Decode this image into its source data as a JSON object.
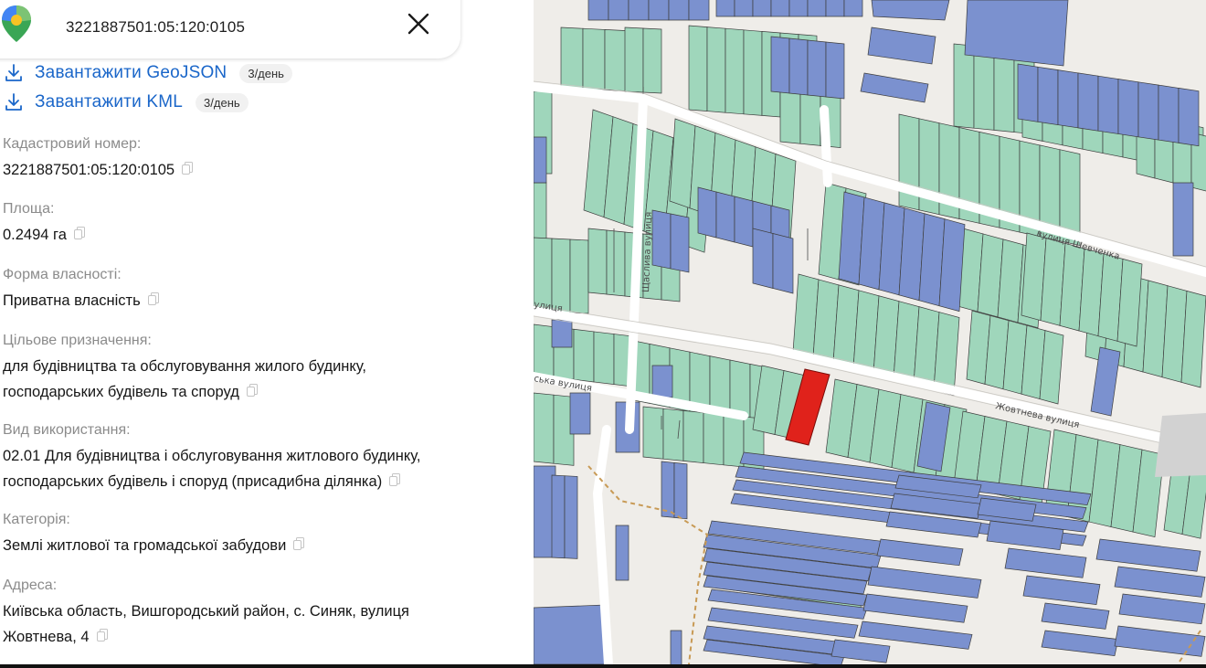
{
  "search": {
    "query": "3221887501:05:120:0105"
  },
  "downloads": [
    {
      "label": "Завантажити GeoJSON",
      "quota": "3/день"
    },
    {
      "label": "Завантажити KML",
      "quota": "3/день"
    }
  ],
  "details": {
    "cadastral": {
      "label": "Кадастровий номер:",
      "value": "3221887501:05:120:0105"
    },
    "area": {
      "label": "Площа:",
      "value": "0.2494 га"
    },
    "ownership": {
      "label": "Форма власності:",
      "value": "Приватна власність"
    },
    "purpose": {
      "label": "Цільове призначення:",
      "line1": "для будівництва та обслуговування жилого будинку,",
      "line2": "господарських будівель та споруд"
    },
    "usage": {
      "label": "Вид використання:",
      "line1": "02.01 Для будівництва і обслуговування житлового будинку,",
      "line2": "господарських будівель і споруд (присадибна ділянка)"
    },
    "category": {
      "label": "Категорія:",
      "value": "Землі житлової та громадської забудови"
    },
    "address": {
      "label": "Адреса:",
      "line1": "Київська область, Вишгородський район, с. Синяк, вулиця",
      "line2": "Жовтнева, 4"
    }
  },
  "map": {
    "streets": {
      "shevchenka": "вулиця Шевченка",
      "shchaslyva": "Щаслива вулиця",
      "zhovtneva": "Жовтнева вулиця",
      "edge_upper": "улиця",
      "edge_lower": "ська вулиця"
    },
    "colors": {
      "private": "#9fd6bb",
      "communal": "#7b91cf",
      "selected": "#e0221b",
      "background": "#efede9"
    }
  },
  "icons": {
    "map_pin": "map-pin-icon",
    "close": "close-icon",
    "download": "download-icon",
    "copy": "copy-icon"
  }
}
